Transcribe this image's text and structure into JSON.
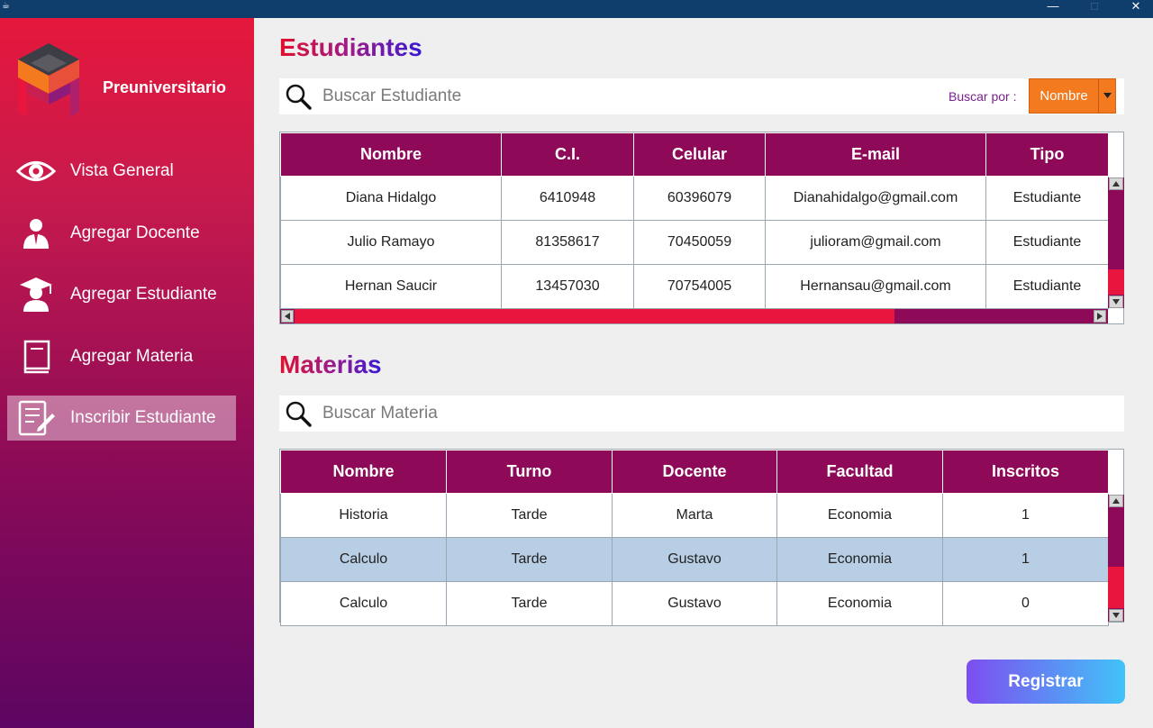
{
  "window": {
    "min": "—",
    "max": "□",
    "close": "✕"
  },
  "sidebar": {
    "brand": "Preuniversitario",
    "items": [
      {
        "label": "Vista General",
        "icon": "eye-icon"
      },
      {
        "label": "Agregar Docente",
        "icon": "teacher-icon"
      },
      {
        "label": "Agregar Estudiante",
        "icon": "graduate-icon"
      },
      {
        "label": "Agregar Materia",
        "icon": "book-icon"
      },
      {
        "label": "Inscribir Estudiante",
        "icon": "edit-form-icon",
        "active": true
      }
    ]
  },
  "estudiantes": {
    "title": "Estudiantes",
    "search_placeholder": "Buscar Estudiante",
    "buscar_por_label": "Buscar por :",
    "buscar_por_value": "Nombre",
    "columns": [
      "Nombre",
      "C.I.",
      "Celular",
      "E-mail",
      "Tipo"
    ],
    "rows": [
      [
        "Diana Hidalgo",
        "6410948",
        "60396079",
        "Dianahidalgo@gmail.com",
        "Estudiante"
      ],
      [
        "Julio Ramayo",
        "81358617",
        "70450059",
        "julioram@gmail.com",
        "Estudiante"
      ],
      [
        "Hernan Saucir",
        "13457030",
        "70754005",
        "Hernansau@gmail.com",
        "Estudiante"
      ]
    ]
  },
  "materias": {
    "title": "Materias",
    "search_placeholder": "Buscar Materia",
    "columns": [
      "Nombre",
      "Turno",
      "Docente",
      "Facultad",
      "Inscritos"
    ],
    "rows": [
      [
        "Historia",
        "Tarde",
        "Marta",
        "Economia",
        "1"
      ],
      [
        "Calculo",
        "Tarde",
        "Gustavo",
        "Economia",
        "1"
      ],
      [
        "Calculo",
        "Tarde",
        "Gustavo",
        "Economia",
        "0"
      ]
    ],
    "selected_row": 1
  },
  "actions": {
    "register_label": "Registrar"
  },
  "colors": {
    "accent": "#8e0a59",
    "highlight": "#e8163e",
    "combo": "#f47a1f",
    "selection": "#b8cee4"
  }
}
